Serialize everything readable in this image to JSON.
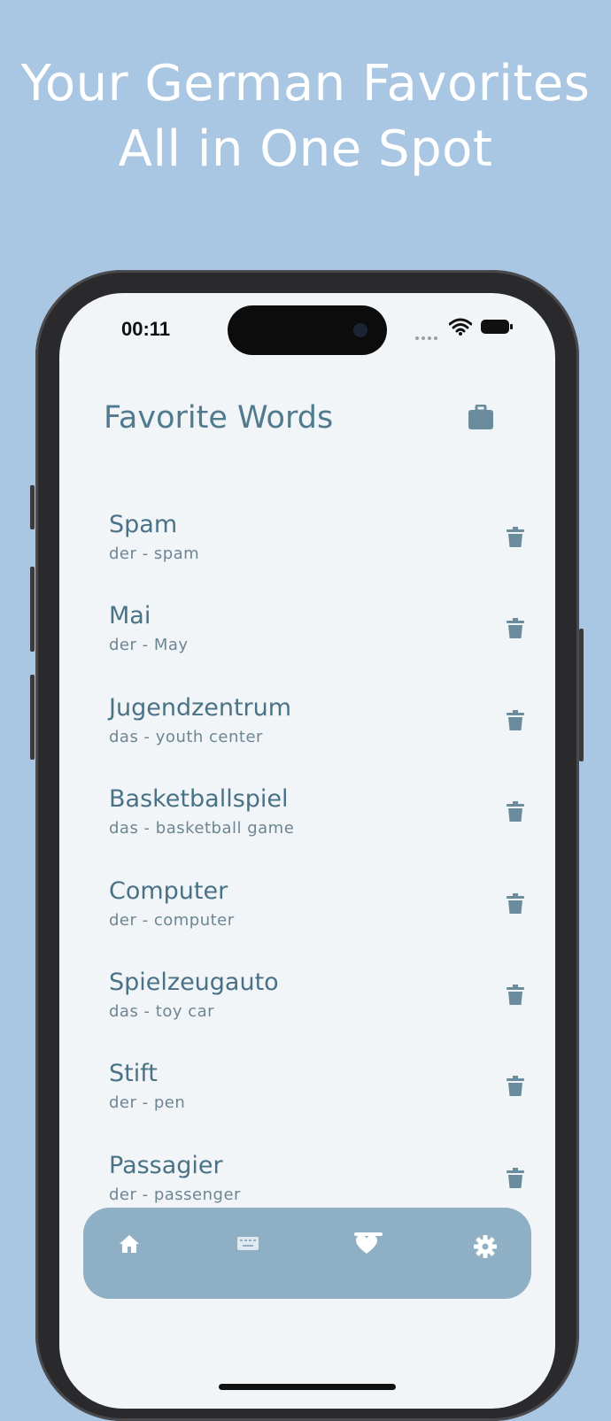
{
  "headline": {
    "line1": "Your German Favorites",
    "line2": "All in One Spot"
  },
  "status_bar": {
    "time": "00:11"
  },
  "header": {
    "title": "Favorite Words",
    "action_icon": "briefcase-icon"
  },
  "words": [
    {
      "term": "Spam",
      "definition": "der - spam"
    },
    {
      "term": "Mai",
      "definition": "der - May"
    },
    {
      "term": "Jugendzentrum",
      "definition": "das - youth center"
    },
    {
      "term": "Basketballspiel",
      "definition": "das - basketball game"
    },
    {
      "term": "Computer",
      "definition": "der - computer"
    },
    {
      "term": "Spielzeugauto",
      "definition": "das - toy car"
    },
    {
      "term": "Stift",
      "definition": "der - pen"
    },
    {
      "term": "Passagier",
      "definition": "der - passenger"
    }
  ],
  "tabbar": {
    "tabs": [
      {
        "icon": "home-icon"
      },
      {
        "icon": "keyboard-icon"
      },
      {
        "icon": "heart-icon",
        "selected": true
      },
      {
        "icon": "gear-icon"
      }
    ]
  },
  "colors": {
    "background": "#a9c6e2",
    "accent": "#507a8e",
    "tabbar": "#8fb0c4",
    "screen": "#f1f5f8"
  }
}
